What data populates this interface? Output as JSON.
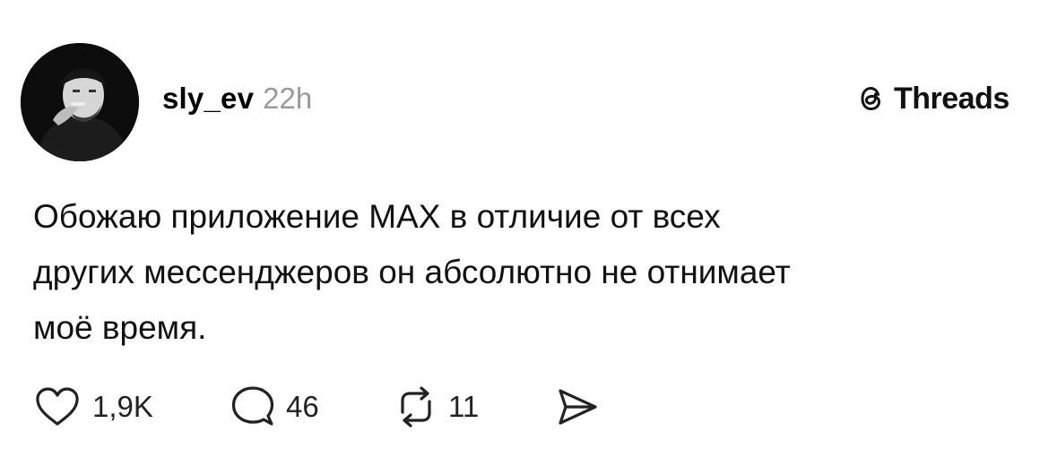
{
  "post": {
    "author": {
      "username": "sly_ev",
      "timestamp": "22h"
    },
    "brand": {
      "label": "Threads",
      "icon": "threads-logo-icon"
    },
    "text": "Обожаю приложение MAX в отличие от всех\nдругих мессенджеров он абсолютно не отнимает\nмоё время.",
    "actions": {
      "likes": {
        "icon": "heart-icon",
        "count": "1,9K"
      },
      "comments": {
        "icon": "comment-icon",
        "count": "46"
      },
      "reposts": {
        "icon": "repost-icon",
        "count": "11"
      },
      "share": {
        "icon": "send-icon"
      }
    }
  }
}
